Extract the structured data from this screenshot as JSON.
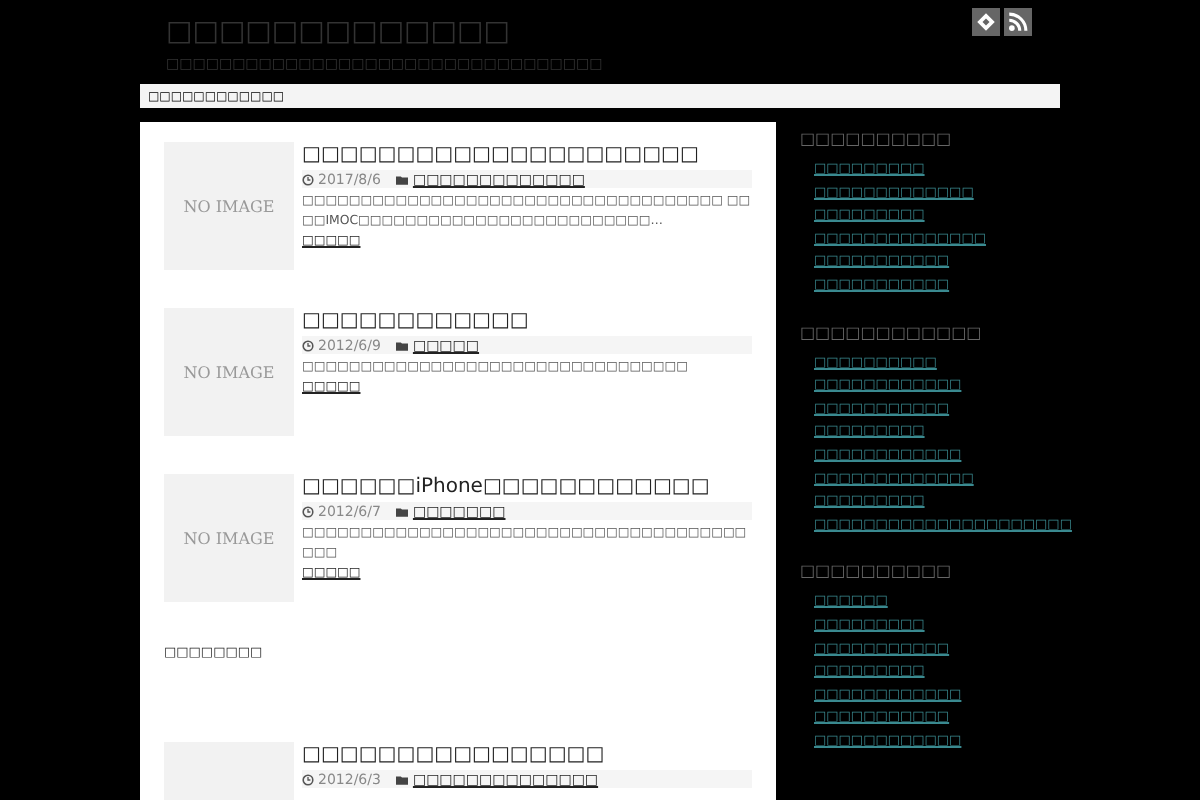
{
  "header": {
    "title": "□□□□□□□□□□□□□",
    "tagline": "□□□□□□□□□□□□□□□□□□□□□□□□□□□□□□□□□"
  },
  "nav": {
    "label": "□□□□□□□□□□□□"
  },
  "posts": [
    {
      "title": "□□□□□□□□□□□□□□□□□□□□□",
      "date": "2017/8/6",
      "category": "□□□□□□□□□□□□□",
      "excerpt": "□□□□□□□□□□□□□□□□□□□□□□□□□□□□□□□□□□□□ □□□□IMOC□□□□□□□□□□□□□□□□□□□□□□□□□…",
      "more": "□□□□□",
      "thumb": "NO IMAGE"
    },
    {
      "title": "□□□□□□□□□□□□",
      "date": "2012/6/9",
      "category": "□□□□□",
      "excerpt": "□□□□□□□□□□□□□□□□□□□□□□□□□□□□□□□□□",
      "more": "□□□□□",
      "thumb": "NO IMAGE"
    },
    {
      "title": "□□□□□□iPhone□□□□□□□□□□□□",
      "date": "2012/6/7",
      "category": "□□□□□□□",
      "excerpt": "□□□□□□□□□□□□□□□□□□□□□□□□□□□□□□□□□□□□□□□□□",
      "more": "□□□□□",
      "thumb": "NO IMAGE"
    }
  ],
  "ad_label": "□□□□□□□□",
  "last_post": {
    "title": "□□□□□□□□□□□□□□□□",
    "date": "2012/6/3",
    "category": "□□□□□□□□□□□□□□"
  },
  "sidebar": [
    {
      "heading": "□□□□□□□□□□",
      "items": [
        "□□□□□□□□□",
        "□□□□□□□□□□□□□",
        "□□□□□□□□□",
        "□□□□□□□□□□□□□□",
        "□□□□□□□□□□□",
        "□□□□□□□□□□□"
      ]
    },
    {
      "heading": "□□□□□□□□□□□□",
      "items": [
        "□□□□□□□□□□",
        "□□□□□□□□□□□□",
        "□□□□□□□□□□□",
        "□□□□□□□□□",
        "□□□□□□□□□□□□",
        "□□□□□□□□□□□□□",
        "□□□□□□□□□",
        "□□□□□□□□□□□□□□□□□□□□□"
      ]
    },
    {
      "heading": "□□□□□□□□□□",
      "items": [
        "□□□□□□",
        "□□□□□□□□□",
        "□□□□□□□□□□□",
        "□□□□□□□□□",
        "□□□□□□□□□□□□",
        "□□□□□□□□□□□",
        "□□□□□□□□□□□□"
      ]
    }
  ]
}
